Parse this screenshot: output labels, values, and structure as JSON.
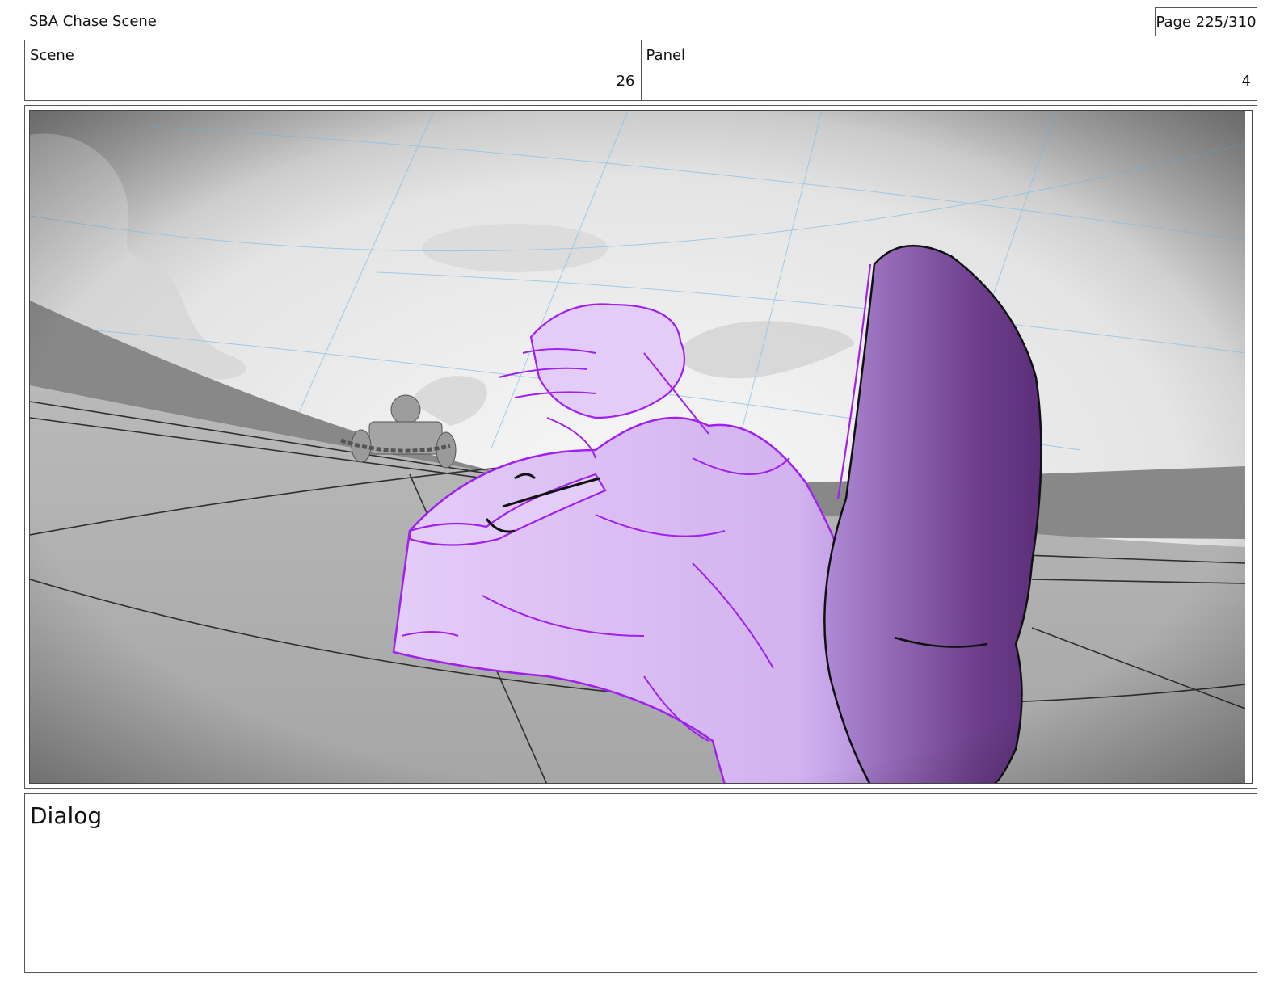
{
  "header": {
    "title": "SBA Chase Scene",
    "page": "Page 225/310"
  },
  "info": {
    "scene_label": "Scene",
    "scene_value": "26",
    "panel_label": "Panel",
    "panel_value": "4"
  },
  "dialog": {
    "label": "Dialog"
  }
}
